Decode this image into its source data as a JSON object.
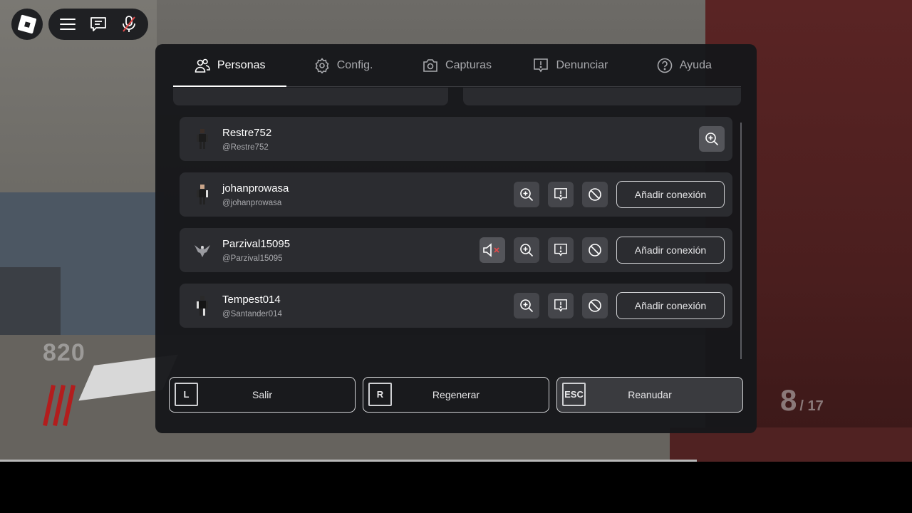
{
  "hud": {
    "score": "820",
    "round_current": "8",
    "round_total": "/ 17"
  },
  "top_bar": {
    "icons": [
      "roblox-logo-icon",
      "hamburger-menu-icon",
      "chat-icon",
      "mic-muted-icon"
    ]
  },
  "tabs": [
    {
      "label": "Personas",
      "icon": "people-icon",
      "active": true
    },
    {
      "label": "Config.",
      "icon": "gear-icon",
      "active": false
    },
    {
      "label": "Capturas",
      "icon": "camera-icon",
      "active": false
    },
    {
      "label": "Denunciar",
      "icon": "report-icon",
      "active": false
    },
    {
      "label": "Ayuda",
      "icon": "help-icon",
      "active": false
    }
  ],
  "players": [
    {
      "name": "Restre752",
      "username": "@Restre752",
      "add_label": ""
    },
    {
      "name": "johanprowasa",
      "username": "@johanprowasa",
      "add_label": "Añadir conexión"
    },
    {
      "name": "Parzival15095",
      "username": "@Parzival15095",
      "add_label": "Añadir conexión"
    },
    {
      "name": "Tempest014",
      "username": "@Santander014",
      "add_label": "Añadir conexión"
    }
  ],
  "footer": {
    "leave": {
      "key": "L",
      "label": "Salir"
    },
    "respawn": {
      "key": "R",
      "label": "Regenerar"
    },
    "resume": {
      "key": "ESC",
      "label": "Reanudar"
    }
  },
  "colors": {
    "panel": "#16171a",
    "card": "#2b2c30",
    "button": "#45464b",
    "mute_x": "#e04a4a"
  }
}
